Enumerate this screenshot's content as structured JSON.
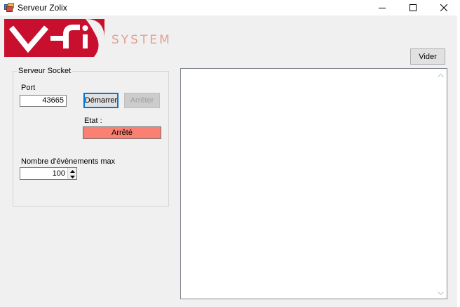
{
  "window": {
    "title": "Serveur Zolix",
    "icon": "app-window-icon",
    "controls": [
      "minimize-icon",
      "maximize-icon",
      "close-icon"
    ]
  },
  "logo": {
    "mark": "VFI",
    "subtitle": "SYSTEM",
    "brand_color": "#c8102e",
    "subtitle_color": "#e0a090"
  },
  "toolbar": {
    "clear_label": "Vider"
  },
  "socket_group": {
    "legend": "Serveur Socket",
    "port_label": "Port",
    "port_value": "43665",
    "start_label": "Démarrer",
    "stop_label": "Arrêter",
    "state_label": "Etat :",
    "state_value": "Arrêté",
    "state_color": "#fa8072",
    "max_events_label": "Nombre d'évènements max",
    "max_events_value": "100"
  },
  "log": {
    "content": ""
  }
}
